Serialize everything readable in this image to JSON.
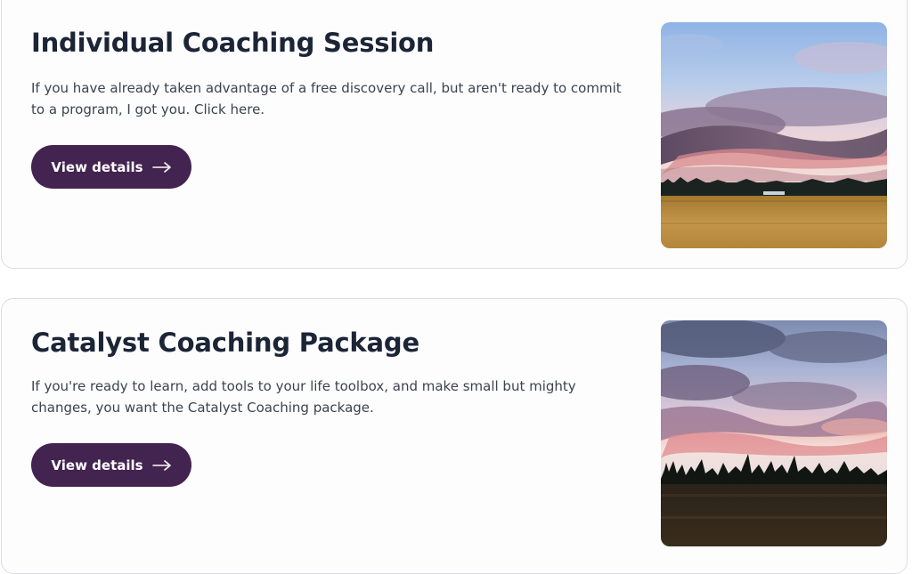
{
  "offerings": [
    {
      "title": "Individual Coaching Session",
      "description": "If you have already taken advantage of a free discovery call, but aren't ready to commit to a program, I got you.  Click here.",
      "button_label": "View details",
      "button_icon": "arrow-right-icon",
      "image_subject": "sunset-clouds-over-golden-field"
    },
    {
      "title": "Catalyst Coaching Package",
      "description": "If you're ready to learn, add tools to your life toolbox, and make small but mighty changes, you want the Catalyst Coaching package.",
      "button_label": "View details",
      "button_icon": "arrow-right-icon",
      "image_subject": "sunset-sky-over-treeline-meadow"
    }
  ],
  "colors": {
    "button_bg": "#43234f",
    "title_text": "#1c2536",
    "body_text": "#3b4350",
    "card_border": "#dcdde3"
  }
}
